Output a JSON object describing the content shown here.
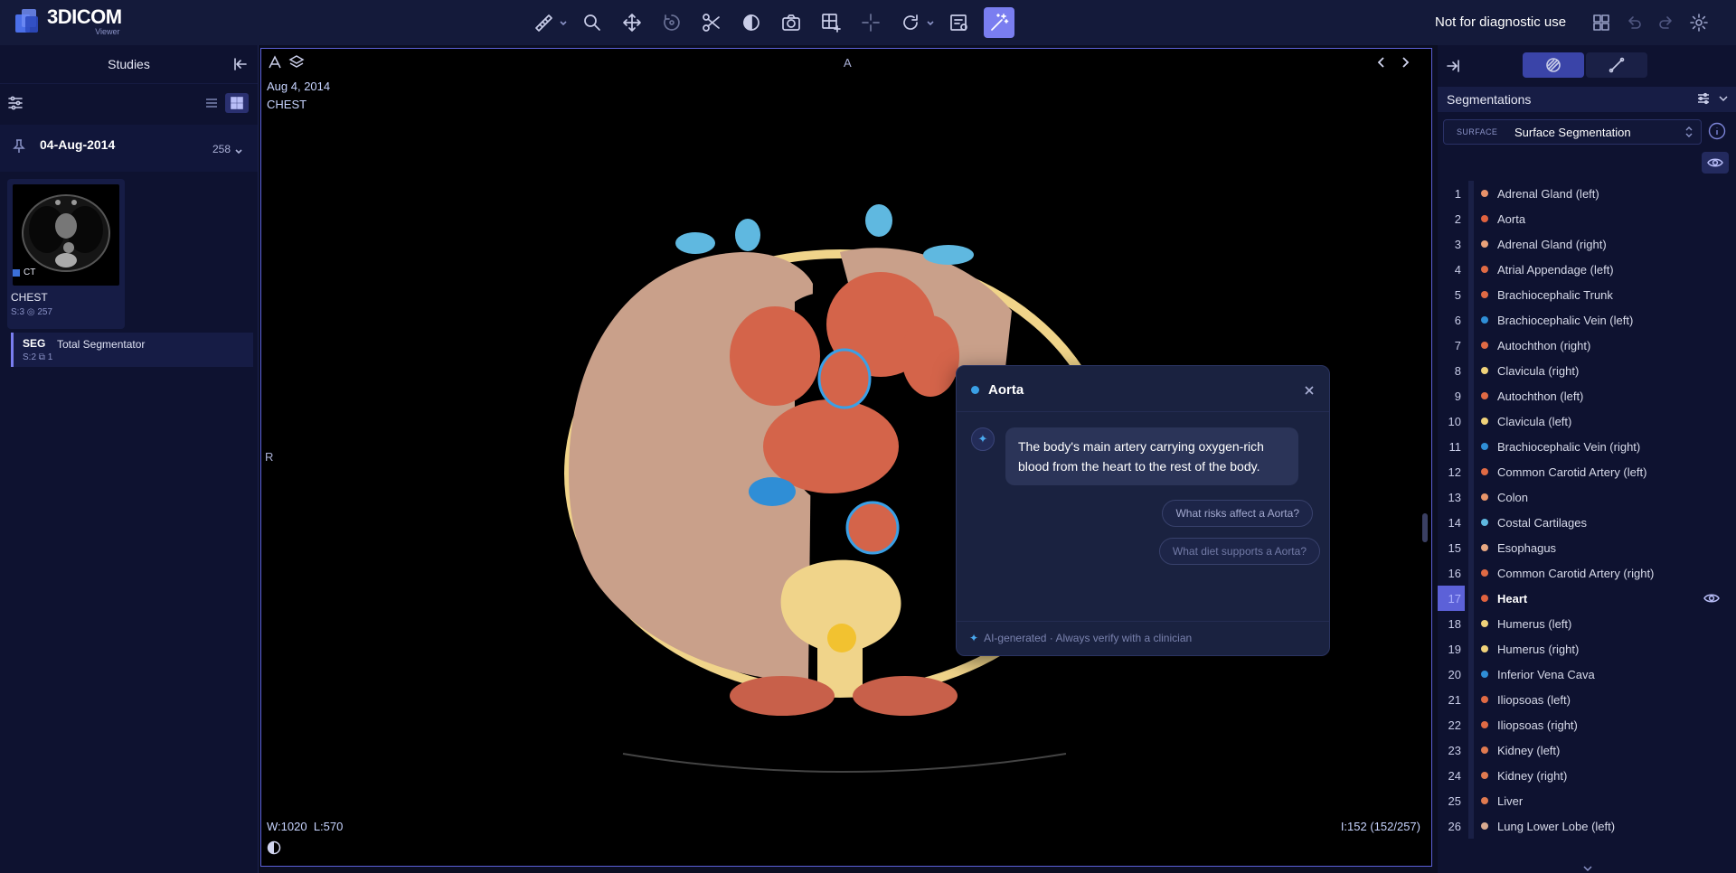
{
  "app": {
    "name": "3DICOM",
    "subtitle": "Viewer",
    "disclaimer": "Not for diagnostic use"
  },
  "toolbar": {
    "tools": [
      "ruler-icon",
      "zoom-icon",
      "pan-icon",
      "rotate-3d-icon",
      "scissors-icon",
      "contrast-icon",
      "camera-icon",
      "grid-add-icon",
      "crosshair-icon",
      "reset-icon",
      "report-icon",
      "magic-wand-icon"
    ],
    "active_tool": "magic-wand-icon"
  },
  "left_panel": {
    "title": "Studies",
    "study_date": "04-Aug-2014",
    "image_count": "258",
    "series": {
      "modality": "CT",
      "name": "CHEST",
      "meta_series": "S:3",
      "meta_count": "257"
    },
    "segmentation": {
      "tag": "SEG",
      "name": "Total Segmentator",
      "meta_series": "S:2",
      "meta_count": "1"
    }
  },
  "viewport": {
    "date": "Aug 4, 2014",
    "body_part": "CHEST",
    "orient_top": "A",
    "orient_left": "R",
    "window_width_label": "W:",
    "window_width": "1020",
    "window_level_label": "L:",
    "window_level": "570",
    "image_index": "I:152 (152/257)"
  },
  "ai_card": {
    "title": "Aorta",
    "answer": "The body's main artery carrying oxygen-rich blood from the heart to the rest of the body.",
    "suggestion_1": "What risks affect a Aorta?",
    "suggestion_2": "What diet supports a Aorta?",
    "footer": "AI-generated · Always verify with a clinician"
  },
  "right_panel": {
    "section_title": "Segmentations",
    "select_type": "SURFACE",
    "select_value": "Surface Segmentation",
    "items": [
      {
        "num": "1",
        "label": "Adrenal Gland (left)",
        "color": "#e8916a"
      },
      {
        "num": "2",
        "label": "Aorta",
        "color": "#e0623f"
      },
      {
        "num": "3",
        "label": "Adrenal Gland (right)",
        "color": "#eaa27a"
      },
      {
        "num": "4",
        "label": "Atrial Appendage (left)",
        "color": "#e06a44"
      },
      {
        "num": "5",
        "label": "Brachiocephalic Trunk",
        "color": "#e06a44"
      },
      {
        "num": "6",
        "label": "Brachiocephalic Vein (left)",
        "color": "#2f8ed6"
      },
      {
        "num": "7",
        "label": "Autochthon (right)",
        "color": "#e06a44"
      },
      {
        "num": "8",
        "label": "Clavicula (right)",
        "color": "#f0d27a"
      },
      {
        "num": "9",
        "label": "Autochthon (left)",
        "color": "#e06a44"
      },
      {
        "num": "10",
        "label": "Clavicula (left)",
        "color": "#f0d27a"
      },
      {
        "num": "11",
        "label": "Brachiocephalic Vein (right)",
        "color": "#2f8ed6"
      },
      {
        "num": "12",
        "label": "Common Carotid Artery (left)",
        "color": "#e06a44"
      },
      {
        "num": "13",
        "label": "Colon",
        "color": "#e8956a"
      },
      {
        "num": "14",
        "label": "Costal Cartilages",
        "color": "#5fb8e0"
      },
      {
        "num": "15",
        "label": "Esophagus",
        "color": "#e8a882"
      },
      {
        "num": "16",
        "label": "Common Carotid Artery (right)",
        "color": "#e06a44"
      },
      {
        "num": "17",
        "label": "Heart",
        "color": "#e0623f"
      },
      {
        "num": "18",
        "label": "Humerus (left)",
        "color": "#f0d27a"
      },
      {
        "num": "19",
        "label": "Humerus (right)",
        "color": "#f0d27a"
      },
      {
        "num": "20",
        "label": "Inferior Vena Cava",
        "color": "#2f8ed6"
      },
      {
        "num": "21",
        "label": "Iliopsoas (left)",
        "color": "#e06a44"
      },
      {
        "num": "22",
        "label": "Iliopsoas (right)",
        "color": "#e06a44"
      },
      {
        "num": "23",
        "label": "Kidney (left)",
        "color": "#e07a50"
      },
      {
        "num": "24",
        "label": "Kidney (right)",
        "color": "#e07a50"
      },
      {
        "num": "25",
        "label": "Liver",
        "color": "#e07a50"
      },
      {
        "num": "26",
        "label": "Lung Lower Lobe (left)",
        "color": "#d8aa90"
      }
    ],
    "selected_num": "17"
  }
}
